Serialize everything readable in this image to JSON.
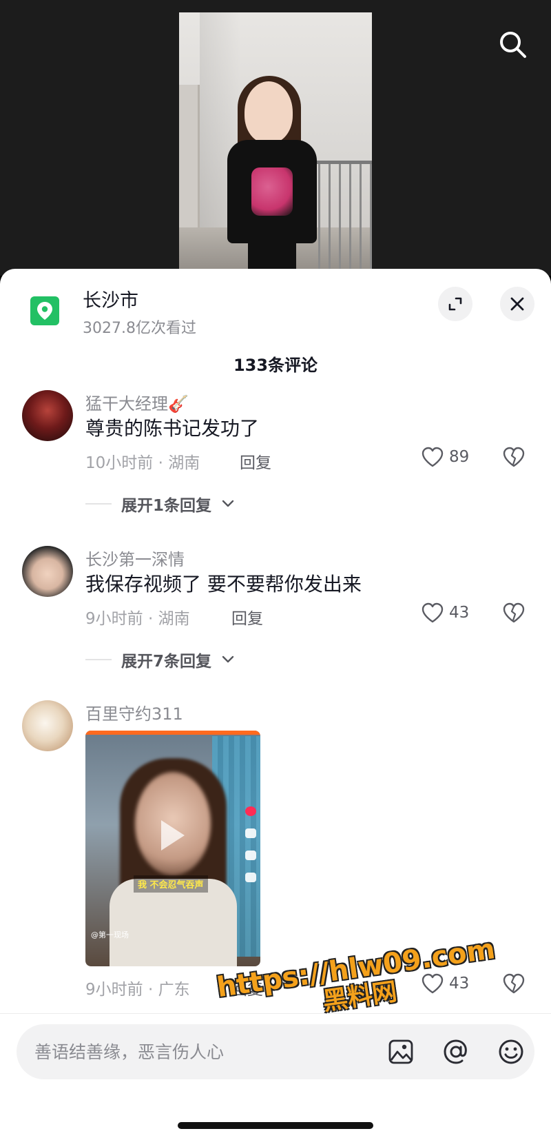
{
  "video": {
    "search_icon": "search-icon"
  },
  "location": {
    "title": "长沙市",
    "views": "3027.8亿次看过",
    "icon": "location-pin-icon",
    "badge_color": "#22c064"
  },
  "comments_header": {
    "count_label": "133条评论"
  },
  "comments": [
    {
      "user": "猛干大经理🎸",
      "text": "尊贵的陈书记发功了",
      "meta": "10小时前 · 湖南",
      "reply_label": "回复",
      "likes": "89",
      "expand_label": "展开1条回复"
    },
    {
      "user": "长沙第一深情",
      "text": "我保存视频了 要不要帮你发出来",
      "meta": "9小时前 · 湖南",
      "reply_label": "回复",
      "likes": "43",
      "expand_label": "展开7条回复"
    },
    {
      "user": "百里守约311",
      "video_subtitle": "我 不会忍气吞声",
      "video_handle": "@第一现场",
      "meta": "9小时前 · 广东",
      "reply_label": "回复",
      "likes": "43"
    }
  ],
  "composer": {
    "placeholder": "善语结善缘，恶言伤人心",
    "icons": [
      "image-icon",
      "at-icon",
      "emoji-icon"
    ]
  },
  "watermark": {
    "line1": "https://hlw09.com",
    "line2": "黑料网"
  },
  "colors": {
    "accent_green": "#22c064",
    "watermark_orange": "#f4a11b"
  }
}
